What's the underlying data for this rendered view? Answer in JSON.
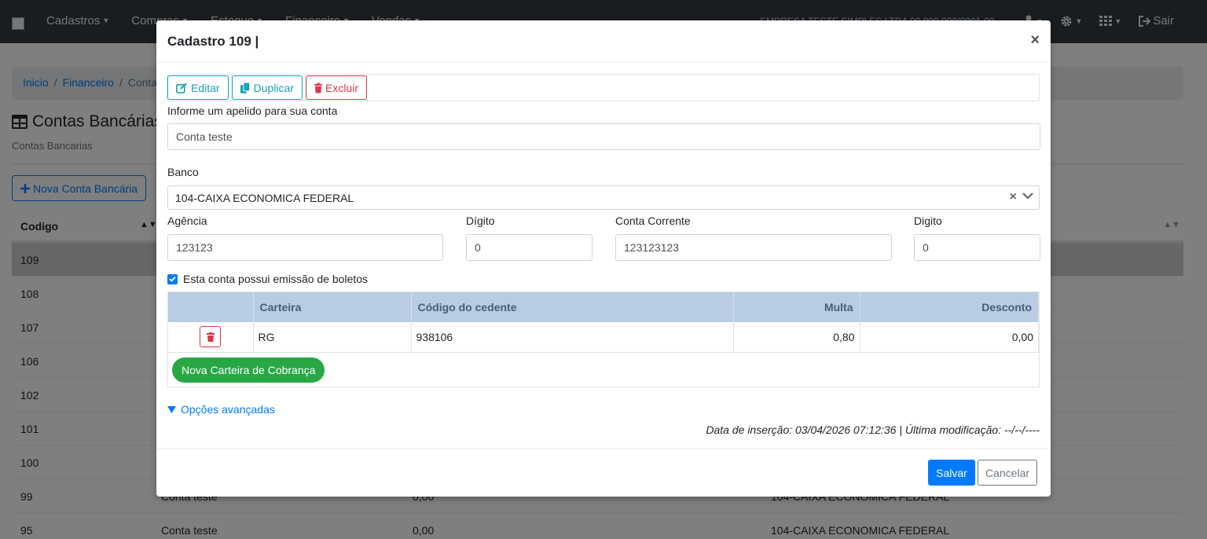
{
  "navbar": {
    "menu": [
      "Cadastros",
      "Compras",
      "Estoque",
      "Financeiro",
      "Vendas"
    ],
    "company": "EMPRESA TESTE SIMPLES LTDA 00.000.000/0001-00",
    "logout": "Sair"
  },
  "breadcrumb": [
    "Inicio",
    "Financeiro",
    "Contas"
  ],
  "page": {
    "title": "Contas Bancárias",
    "subtitle": "Contas Bancarias",
    "new_button": "Nova Conta Bancária",
    "table_header": "Codigo",
    "rows": [
      {
        "codigo": "109",
        "nome": "",
        "saldo": "",
        "banco": ""
      },
      {
        "codigo": "108",
        "nome": "",
        "saldo": "",
        "banco": ""
      },
      {
        "codigo": "107",
        "nome": "",
        "saldo": "",
        "banco": ""
      },
      {
        "codigo": "106",
        "nome": "",
        "saldo": "",
        "banco": ""
      },
      {
        "codigo": "102",
        "nome": "",
        "saldo": "",
        "banco": ""
      },
      {
        "codigo": "101",
        "nome": "",
        "saldo": "",
        "banco": ""
      },
      {
        "codigo": "100",
        "nome": "",
        "saldo": "",
        "banco": ""
      },
      {
        "codigo": "99",
        "nome": "Conta teste",
        "saldo": "0,00",
        "banco": "104-CAIXA ECONOMICA FEDERAL"
      },
      {
        "codigo": "95",
        "nome": "Conta teste",
        "saldo": "0,00",
        "banco": "104-CAIXA ECONOMICA FEDERAL"
      }
    ]
  },
  "modal": {
    "title": "Cadastro 109 |",
    "close": "×",
    "toolbar": {
      "edit": "Editar",
      "duplicate": "Duplicar",
      "delete": "Excluir"
    },
    "apelido_label": "Informe um apelido para sua conta",
    "apelido_value": "Conta teste",
    "banco_label": "Banco",
    "banco_value": "104-CAIXA ECONOMICA FEDERAL",
    "agencia_label": "Agência",
    "agencia_value": "123123",
    "digito1_label": "Dígito",
    "digito1_value": "0",
    "conta_label": "Conta Corrente",
    "conta_value": "123123123",
    "digito2_label": "Digito",
    "digito2_value": "0",
    "boleto_check_label": "Esta conta possui emissão de boletos",
    "carteiras": {
      "headers": [
        "",
        "Carteira",
        "Código do cedente",
        "Multa",
        "Desconto"
      ],
      "rows": [
        {
          "carteira": "RG",
          "cedente": "938106",
          "multa": "0,80",
          "desconto": "0,00"
        }
      ],
      "new_button": "Nova Carteira de Cobrança"
    },
    "advanced": "Opções avançadas",
    "meta": "Data de inserção: 03/04/2026 07:12:36 | Última modificação: --/--/----",
    "save": "Salvar",
    "cancel": "Cancelar"
  }
}
